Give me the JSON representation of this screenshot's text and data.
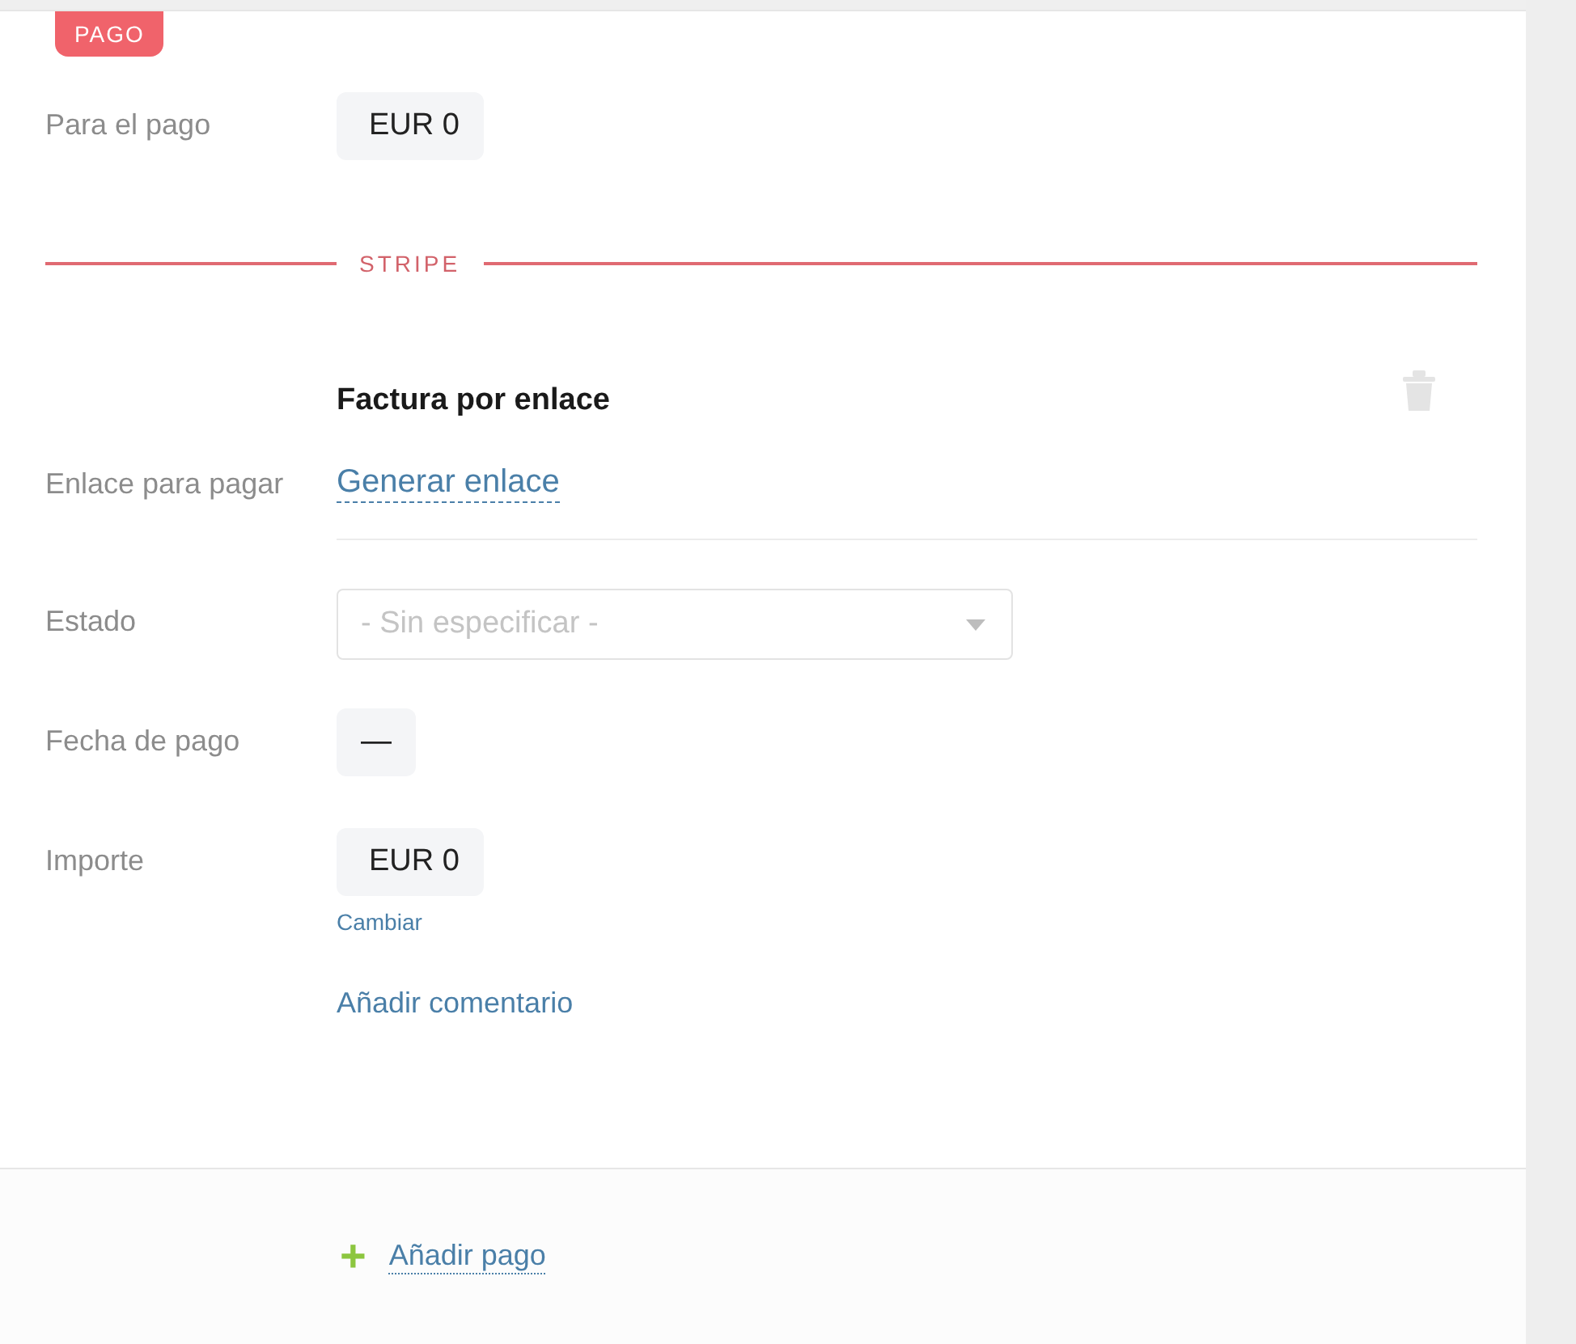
{
  "section_badge": "PAGO",
  "to_pay": {
    "label": "Para el pago",
    "value": "EUR 0"
  },
  "provider": "STRIPE",
  "payment": {
    "title": "Factura por enlace",
    "link": {
      "label": "Enlace para pagar",
      "action": "Generar enlace"
    },
    "status": {
      "label": "Estado",
      "placeholder": "- Sin especificar -"
    },
    "date": {
      "label": "Fecha de pago",
      "value": "—"
    },
    "amount": {
      "label": "Importe",
      "value": "EUR 0",
      "change": "Cambiar"
    },
    "comment": "Añadir comentario"
  },
  "add_payment": {
    "icon": "+",
    "label": "Añadir pago"
  }
}
